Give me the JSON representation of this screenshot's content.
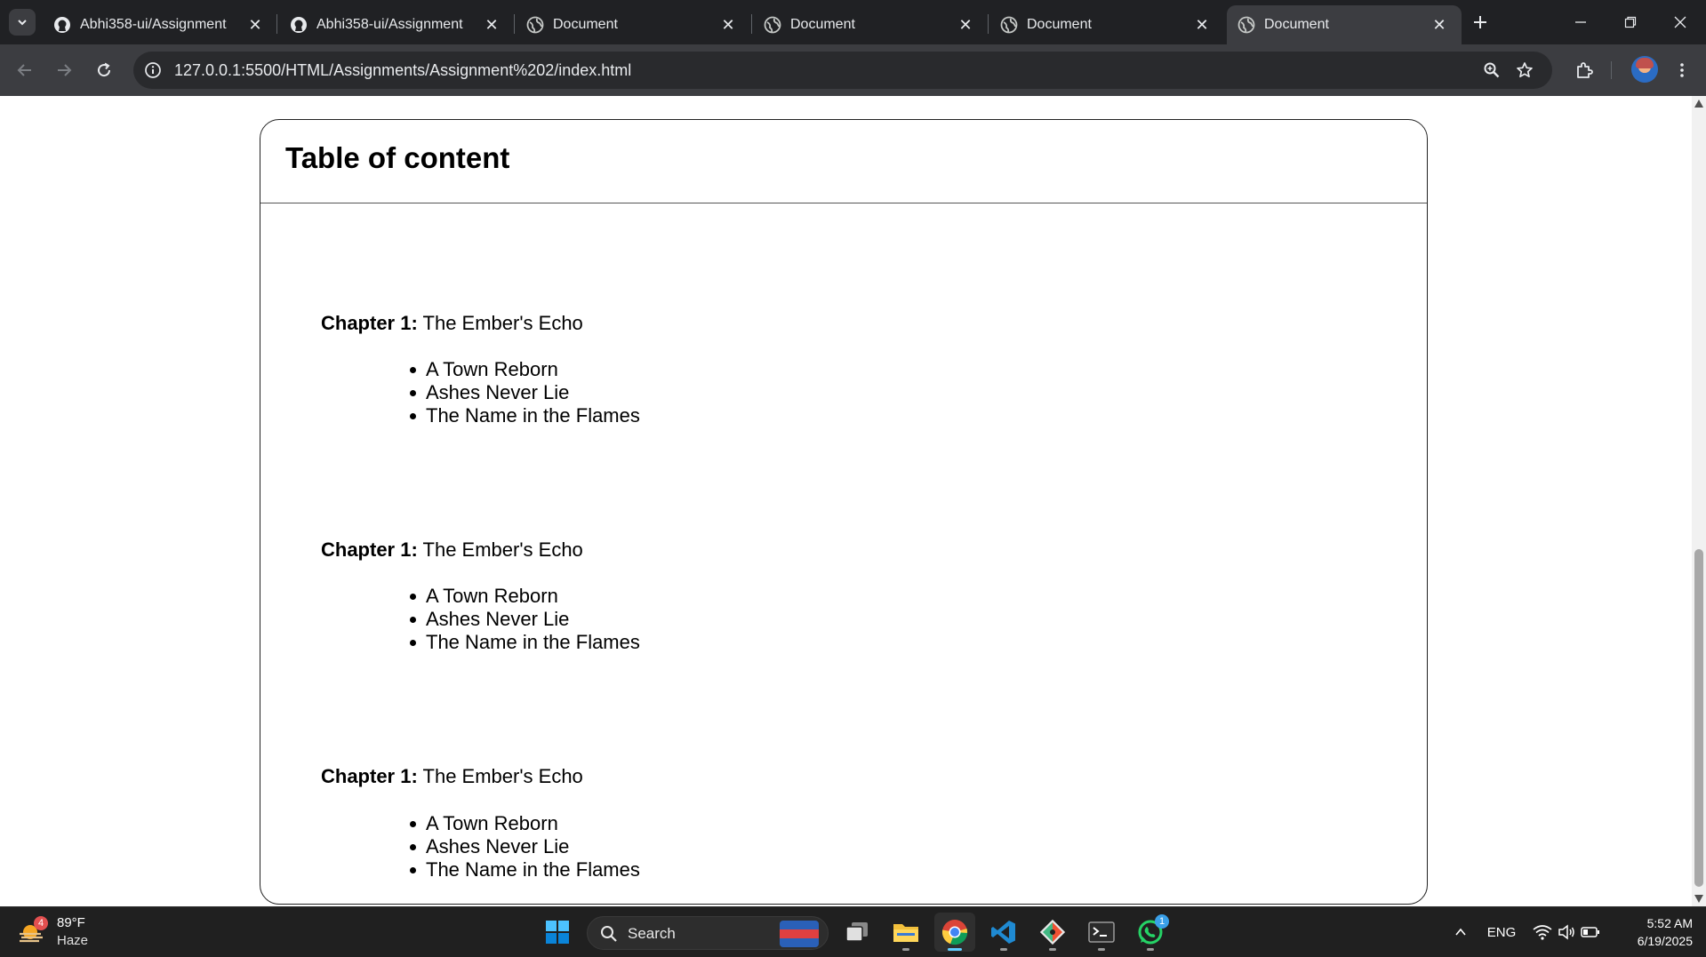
{
  "browser": {
    "tabs": [
      {
        "title": "Abhi358-ui/Assignment",
        "icon": "github-icon",
        "active": false
      },
      {
        "title": "Abhi358-ui/Assignment",
        "icon": "github-icon",
        "active": false
      },
      {
        "title": "Document",
        "icon": "globe-icon",
        "active": false
      },
      {
        "title": "Document",
        "icon": "globe-icon",
        "active": false
      },
      {
        "title": "Document",
        "icon": "globe-icon",
        "active": false
      },
      {
        "title": "Document",
        "icon": "globe-icon",
        "active": true
      }
    ],
    "url": "127.0.0.1:5500/HTML/Assignments/Assignment%202/index.html"
  },
  "page": {
    "title": "Table of content",
    "chapters": [
      {
        "label": "Chapter 1:",
        "name": "The Ember's Echo",
        "sections": [
          "A Town Reborn",
          "Ashes Never Lie",
          "The Name in the Flames"
        ]
      },
      {
        "label": "Chapter 1:",
        "name": "The Ember's Echo",
        "sections": [
          "A Town Reborn",
          "Ashes Never Lie",
          "The Name in the Flames"
        ]
      },
      {
        "label": "Chapter 1:",
        "name": "The Ember's Echo",
        "sections": [
          "A Town Reborn",
          "Ashes Never Lie",
          "The Name in the Flames"
        ]
      }
    ]
  },
  "taskbar": {
    "weather": {
      "temp": "89°F",
      "condition": "Haze",
      "badge": "4"
    },
    "search_label": "Search",
    "whatsapp_badge": "1",
    "language": "ENG",
    "time": "5:52 AM",
    "date": "6/19/2025"
  },
  "colors": {
    "tab_strip": "#202124",
    "toolbar": "#3c3d41",
    "taskbar": "#202020",
    "active_indicator": "#60cdff"
  }
}
